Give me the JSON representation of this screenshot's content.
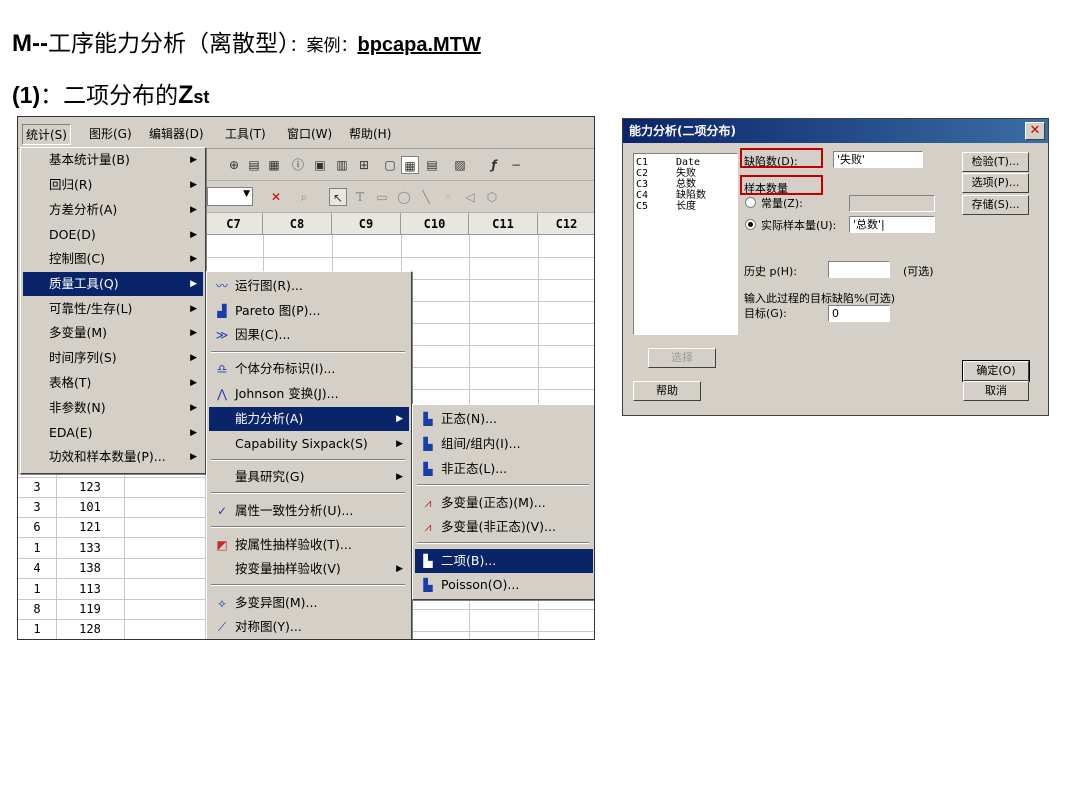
{
  "slide": {
    "title_prefix": "M--",
    "title_main": "工序能力分析（离散型）",
    "title_colon": "：",
    "title_case_label": "案例：",
    "title_file": "bpcapa.MTW",
    "subtitle_num": "(1)",
    "subtitle_text": "：二项分布的",
    "subtitle_z": "Z",
    "subtitle_st": "st"
  },
  "menubar": [
    {
      "label": "统计(S)"
    },
    {
      "label": "图形(G)"
    },
    {
      "label": "编辑器(D)"
    },
    {
      "label": "工具(T)"
    },
    {
      "label": "窗口(W)"
    },
    {
      "label": "帮助(H)"
    }
  ],
  "columns": [
    "C7",
    "C8",
    "C9",
    "C10",
    "C11",
    "C12"
  ],
  "stat_menu": [
    {
      "label": "基本统计量(B)"
    },
    {
      "label": "回归(R)"
    },
    {
      "label": "方差分析(A)"
    },
    {
      "label": "DOE(D)"
    },
    {
      "label": "控制图(C)"
    },
    {
      "label": "质量工具(Q)"
    },
    {
      "label": "可靠性/生存(L)"
    },
    {
      "label": "多变量(M)"
    },
    {
      "label": "时间序列(S)"
    },
    {
      "label": "表格(T)"
    },
    {
      "label": "非参数(N)"
    },
    {
      "label": "EDA(E)"
    },
    {
      "label": "功效和样本数量(P)..."
    }
  ],
  "quality_menu": {
    "run_chart": "运行图(R)...",
    "pareto": "Pareto 图(P)...",
    "cause_effect": "因果(C)...",
    "individual_dist": "个体分布标识(I)...",
    "johnson": "Johnson 变换(J)...",
    "capability": "能力分析(A)",
    "sixpack": "Capability Sixpack(S)",
    "gage": "量具研究(G)",
    "attribute_agreement": "属性一致性分析(U)...",
    "attr_sampling": "按属性抽样验收(T)...",
    "var_sampling": "按变量抽样验收(V)",
    "multivari": "多变异图(M)...",
    "symmetry": "对称图(Y)..."
  },
  "capability_menu": {
    "normal": "正态(N)...",
    "between_within": "组间/组内(I)...",
    "nonnormal": "非正态(L)...",
    "multi_normal": "多变量(正态)(M)...",
    "multi_nonnormal": "多变量(非正态)(V)...",
    "binomial": "二项(B)...",
    "poisson": "Poisson(O)..."
  },
  "data_rows": [
    [
      "3",
      "123"
    ],
    [
      "3",
      "101"
    ],
    [
      "6",
      "121"
    ],
    [
      "1",
      "133"
    ],
    [
      "4",
      "138"
    ],
    [
      "1",
      "113"
    ],
    [
      "8",
      "119"
    ],
    [
      "1",
      "128"
    ]
  ],
  "dialog": {
    "title": "能力分析(二项分布)",
    "variables": [
      {
        "col": "C1",
        "name": "Date"
      },
      {
        "col": "C2",
        "name": "失败"
      },
      {
        "col": "C3",
        "name": "总数"
      },
      {
        "col": "C4",
        "name": "缺陷数"
      },
      {
        "col": "C5",
        "name": "长度"
      }
    ],
    "defects_label": "缺陷数(D):",
    "defects_value": "'失败'",
    "sample_size_label": "样本数量",
    "constant_label": "常量(Z):",
    "actual_label": "实际样本量(U):",
    "actual_value": "'总数'|",
    "history_label": "历史 p(H):",
    "optional": "(可选)",
    "target_prompt": "输入此过程的目标缺陷%(可选)",
    "target_label": "目标(G):",
    "target_value": "0",
    "btn_test": "检验(T)...",
    "btn_options": "选项(P)...",
    "btn_storage": "存储(S)...",
    "btn_select": "选择",
    "btn_help": "帮助",
    "btn_ok": "确定(O)",
    "btn_cancel": "取消"
  }
}
